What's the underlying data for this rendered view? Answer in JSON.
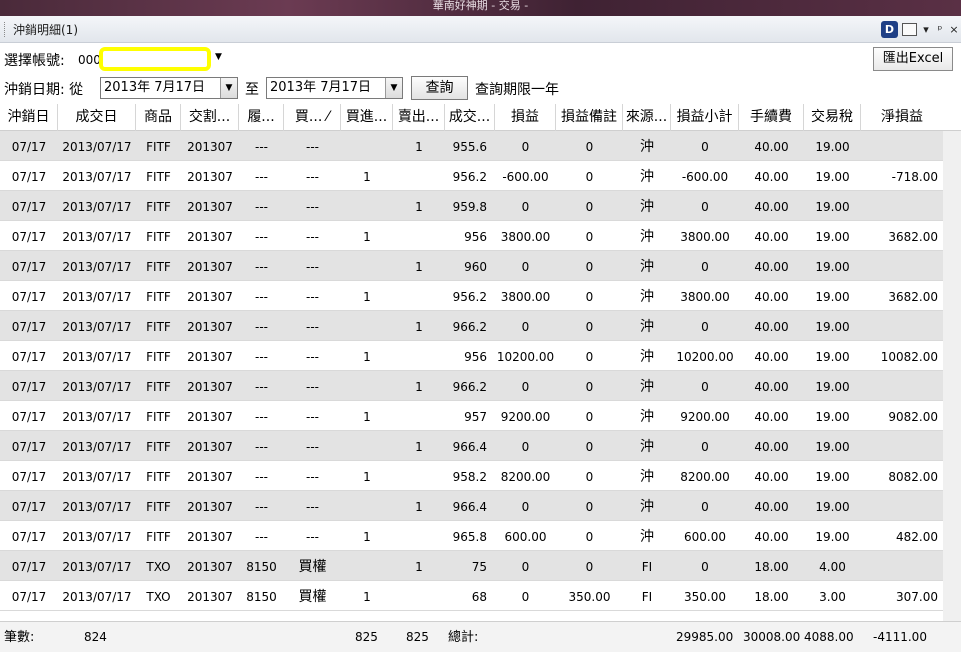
{
  "window": {
    "top_title": "華南好神期 - 交易 -",
    "panel_title": "沖銷明細(1)"
  },
  "account": {
    "label": "選擇帳號:",
    "prefix": "000",
    "value": ""
  },
  "export_label": "匯出Excel",
  "dates": {
    "label": "沖銷日期: 從",
    "from": "2013年  7月17日",
    "to_label": "至",
    "to": "2013年  7月17日",
    "query_label": "查詢",
    "note": "查詢期限一年"
  },
  "columns": [
    "沖銷日",
    "成交日",
    "商品",
    "交割...",
    "履...",
    "買... ⁄",
    "買進...",
    "賣出...",
    "成交...",
    "損益",
    "損益備註",
    "來源...",
    "損益小計",
    "手續費",
    "交易稅",
    "淨損益"
  ],
  "rows": [
    [
      "07/17",
      "2013/07/17",
      "FITF",
      "201307",
      "---",
      "---",
      "",
      "1",
      "955.6",
      "0",
      "0",
      "沖",
      "0",
      "40.00",
      "19.00",
      ""
    ],
    [
      "07/17",
      "2013/07/17",
      "FITF",
      "201307",
      "---",
      "---",
      "1",
      "",
      "956.2",
      "-600.00",
      "0",
      "沖",
      "-600.00",
      "40.00",
      "19.00",
      "-718.00"
    ],
    [
      "07/17",
      "2013/07/17",
      "FITF",
      "201307",
      "---",
      "---",
      "",
      "1",
      "959.8",
      "0",
      "0",
      "沖",
      "0",
      "40.00",
      "19.00",
      ""
    ],
    [
      "07/17",
      "2013/07/17",
      "FITF",
      "201307",
      "---",
      "---",
      "1",
      "",
      "956",
      "3800.00",
      "0",
      "沖",
      "3800.00",
      "40.00",
      "19.00",
      "3682.00"
    ],
    [
      "07/17",
      "2013/07/17",
      "FITF",
      "201307",
      "---",
      "---",
      "",
      "1",
      "960",
      "0",
      "0",
      "沖",
      "0",
      "40.00",
      "19.00",
      ""
    ],
    [
      "07/17",
      "2013/07/17",
      "FITF",
      "201307",
      "---",
      "---",
      "1",
      "",
      "956.2",
      "3800.00",
      "0",
      "沖",
      "3800.00",
      "40.00",
      "19.00",
      "3682.00"
    ],
    [
      "07/17",
      "2013/07/17",
      "FITF",
      "201307",
      "---",
      "---",
      "",
      "1",
      "966.2",
      "0",
      "0",
      "沖",
      "0",
      "40.00",
      "19.00",
      ""
    ],
    [
      "07/17",
      "2013/07/17",
      "FITF",
      "201307",
      "---",
      "---",
      "1",
      "",
      "956",
      "10200.00",
      "0",
      "沖",
      "10200.00",
      "40.00",
      "19.00",
      "10082.00"
    ],
    [
      "07/17",
      "2013/07/17",
      "FITF",
      "201307",
      "---",
      "---",
      "",
      "1",
      "966.2",
      "0",
      "0",
      "沖",
      "0",
      "40.00",
      "19.00",
      ""
    ],
    [
      "07/17",
      "2013/07/17",
      "FITF",
      "201307",
      "---",
      "---",
      "1",
      "",
      "957",
      "9200.00",
      "0",
      "沖",
      "9200.00",
      "40.00",
      "19.00",
      "9082.00"
    ],
    [
      "07/17",
      "2013/07/17",
      "FITF",
      "201307",
      "---",
      "---",
      "",
      "1",
      "966.4",
      "0",
      "0",
      "沖",
      "0",
      "40.00",
      "19.00",
      ""
    ],
    [
      "07/17",
      "2013/07/17",
      "FITF",
      "201307",
      "---",
      "---",
      "1",
      "",
      "958.2",
      "8200.00",
      "0",
      "沖",
      "8200.00",
      "40.00",
      "19.00",
      "8082.00"
    ],
    [
      "07/17",
      "2013/07/17",
      "FITF",
      "201307",
      "---",
      "---",
      "",
      "1",
      "966.4",
      "0",
      "0",
      "沖",
      "0",
      "40.00",
      "19.00",
      ""
    ],
    [
      "07/17",
      "2013/07/17",
      "FITF",
      "201307",
      "---",
      "---",
      "1",
      "",
      "965.8",
      "600.00",
      "0",
      "沖",
      "600.00",
      "40.00",
      "19.00",
      "482.00"
    ],
    [
      "07/17",
      "2013/07/17",
      "TXO",
      "201307",
      "8150",
      "買權",
      "",
      "1",
      "75",
      "0",
      "0",
      "FI",
      "0",
      "18.00",
      "4.00",
      ""
    ],
    [
      "07/17",
      "2013/07/17",
      "TXO",
      "201307",
      "8150",
      "買權",
      "1",
      "",
      "68",
      "0",
      "350.00",
      "FI",
      "350.00",
      "18.00",
      "3.00",
      "307.00"
    ]
  ],
  "footer": {
    "count_label": "筆數:",
    "count": "824",
    "buy_total": "825",
    "sell_total": "825",
    "total_label": "總計:",
    "subtotal_sum": "29985.00",
    "fee_sum": "30008.00",
    "tax_sum": "4088.00",
    "net_sum": "-4111.00"
  }
}
